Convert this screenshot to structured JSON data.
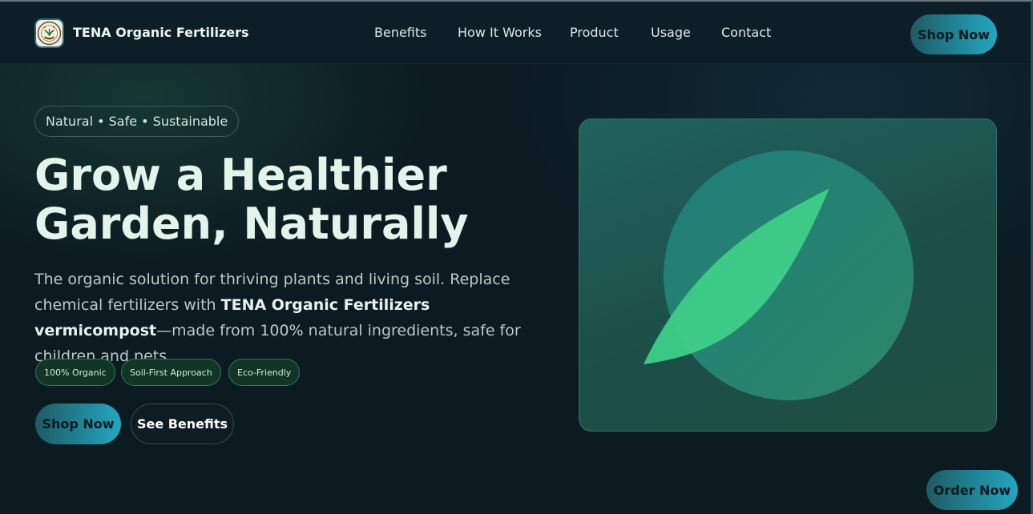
{
  "brand": {
    "name": "TENA Organic Fertilizers",
    "logo_icon": "tena-organic-logo-icon"
  },
  "nav": {
    "items": [
      "Benefits",
      "How It Works",
      "Product",
      "Usage",
      "Contact"
    ],
    "cta": "Shop Now"
  },
  "hero": {
    "tagline": "Natural • Safe • Sustainable",
    "headline_line1": "Grow a Healthier",
    "headline_line2": "Garden, Naturally",
    "desc_part1": "The organic solution for thriving plants and living soil. Replace chemical fertilizers with ",
    "desc_bold": "TENA Organic Fertilizers vermicompost",
    "desc_part2": "—made from 100% natural ingredients, safe for children and pets.",
    "chips": [
      "100% Organic",
      "Soil-First Approach",
      "Eco-Friendly"
    ],
    "primary_btn": "Shop Now",
    "secondary_btn": "See Benefits",
    "illustration_icon": "leaf-icon"
  },
  "floating": {
    "order_btn": "Order Now"
  },
  "colors": {
    "accent_start": "#1f5a64",
    "accent_end": "#22a7c0",
    "leaf": "#3fcd88",
    "background": "#0c1a22"
  }
}
